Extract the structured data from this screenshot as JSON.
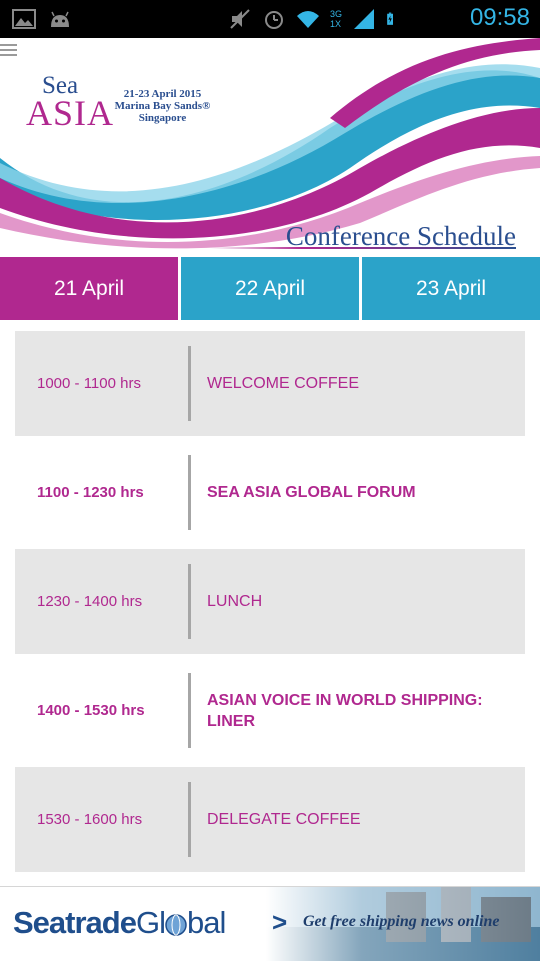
{
  "status_bar": {
    "time": "09:58",
    "icons": [
      "image-icon",
      "android-icon",
      "mute-icon",
      "alarm-icon",
      "wifi-icon",
      "signal-icon",
      "battery-icon"
    ],
    "network_label": "3G",
    "network_sub": "1X"
  },
  "header": {
    "logo_top": "Sea",
    "logo_bottom": "ASIA",
    "event_dates": "21-23 April 2015",
    "event_venue": "Marina Bay Sands®",
    "event_city": "Singapore",
    "page_title": "Conference Schedule"
  },
  "tabs": [
    {
      "label": "21 April",
      "selected": true
    },
    {
      "label": "22 April",
      "selected": false
    },
    {
      "label": "23 April",
      "selected": false
    }
  ],
  "schedule": [
    {
      "time": "1000 - 1100 hrs",
      "session": "WELCOME COFFEE",
      "bold": false
    },
    {
      "time": "1100 - 1230 hrs",
      "session": "SEA ASIA GLOBAL FORUM",
      "bold": true
    },
    {
      "time": "1230 - 1400 hrs",
      "session": "LUNCH",
      "bold": false
    },
    {
      "time": "1400 - 1530 hrs",
      "session": "ASIAN VOICE IN WORLD SHIPPING: LINER",
      "bold": true
    },
    {
      "time": "1530 - 1600 hrs",
      "session": "DELEGATE COFFEE",
      "bold": false
    }
  ],
  "footer_ad": {
    "brand_bold": "Seatrade",
    "brand_light": "Gl",
    "brand_end": "bal",
    "chevron": ">",
    "tagline": "Get free shipping news online"
  },
  "colors": {
    "magenta": "#b0288f",
    "teal": "#2ba3c9",
    "navy": "#2a4e8f",
    "row_grey": "#e6e6e6"
  }
}
